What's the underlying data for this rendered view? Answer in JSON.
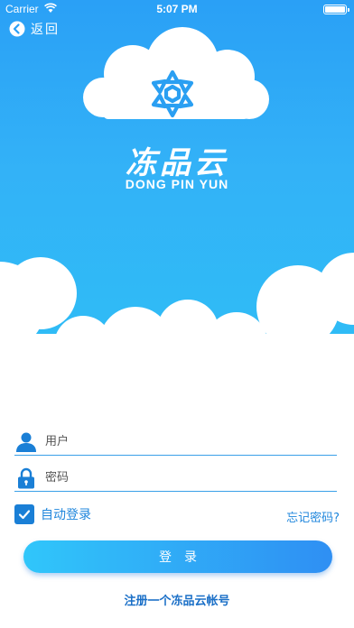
{
  "status_bar": {
    "carrier": "Carrier",
    "time": "5:07 PM"
  },
  "nav": {
    "back_label": "返回"
  },
  "brand": {
    "name_cn": "冻品云",
    "name_en": "DONG PIN YUN"
  },
  "form": {
    "username_placeholder": "用户",
    "password_placeholder": "密码",
    "remember_label": "自动登录",
    "remember_checked": true,
    "forgot_label": "忘记密码?"
  },
  "actions": {
    "login_label": "登录",
    "register_label": "注册一个冻品云帐号"
  },
  "colors": {
    "sky": "#2aa0f6",
    "accent": "#1f86dc",
    "button_start": "#30c6fa",
    "button_end": "#2f8ff3"
  },
  "icons": [
    "wifi-icon",
    "battery-icon",
    "back-arrow-icon",
    "snowflake-logo-icon",
    "user-icon",
    "lock-icon",
    "check-icon"
  ]
}
